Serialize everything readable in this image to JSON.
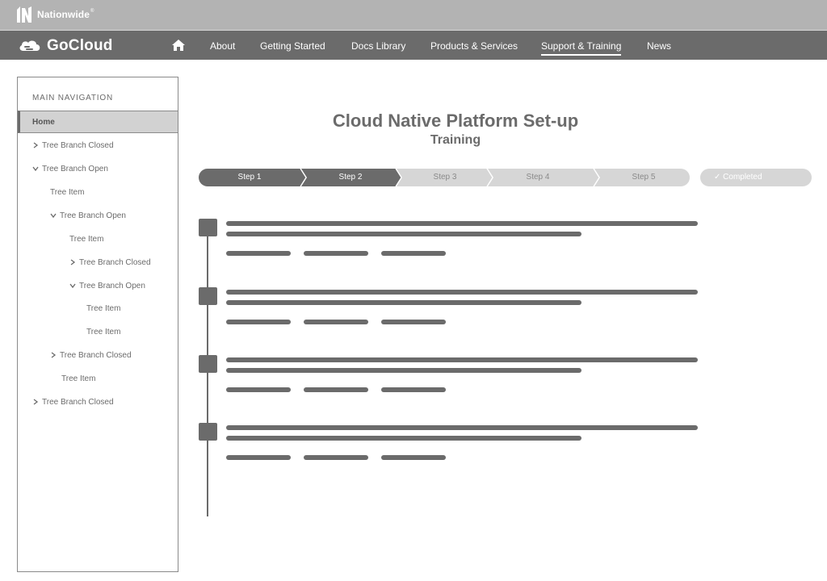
{
  "brand": {
    "name": "Nationwide",
    "mark": "®"
  },
  "app": {
    "title": "GoCloud"
  },
  "nav": {
    "home_icon": "home-icon",
    "links": [
      "About",
      "Getting Started",
      "Docs Library",
      "Products & Services",
      "Support & Training",
      "News"
    ],
    "active": "Support & Training"
  },
  "sidebar": {
    "heading": "MAIN NAVIGATION",
    "home": "Home",
    "items": [
      {
        "label": "Tree Branch Closed",
        "type": "branch-closed"
      },
      {
        "label": "Tree Branch Open",
        "type": "branch-open"
      },
      {
        "label": "Tree Item",
        "type": "item"
      },
      {
        "label": "Tree Branch Open",
        "type": "branch-open"
      },
      {
        "label": "Tree Item",
        "type": "item"
      },
      {
        "label": "Tree Branch Closed",
        "type": "branch-closed"
      },
      {
        "label": "Tree Branch Open",
        "type": "branch-open"
      },
      {
        "label": "Tree Item",
        "type": "item"
      },
      {
        "label": "Tree Item",
        "type": "item"
      },
      {
        "label": "Tree Branch Closed",
        "type": "branch-closed"
      },
      {
        "label": "Tree Item",
        "type": "item"
      },
      {
        "label": "Tree Branch Closed",
        "type": "branch-closed"
      }
    ]
  },
  "page": {
    "title": "Cloud Native Platform Set-up",
    "subtitle": "Training"
  },
  "stepper": {
    "steps": [
      {
        "label": "Step 1",
        "state": "done"
      },
      {
        "label": "Step 2",
        "state": "current"
      },
      {
        "label": "Step 3",
        "state": "pending"
      },
      {
        "label": "Step 4",
        "state": "pending"
      },
      {
        "label": "Step 5",
        "state": "pending"
      }
    ],
    "completed_label": "✓ Completed"
  },
  "timeline": {
    "entry_count_visible": 4
  },
  "colors": {
    "dark": "#6b6b6b",
    "light": "#d6d6d6",
    "topbar": "#b3b3b3",
    "text_on_dark": "#ffffff"
  }
}
